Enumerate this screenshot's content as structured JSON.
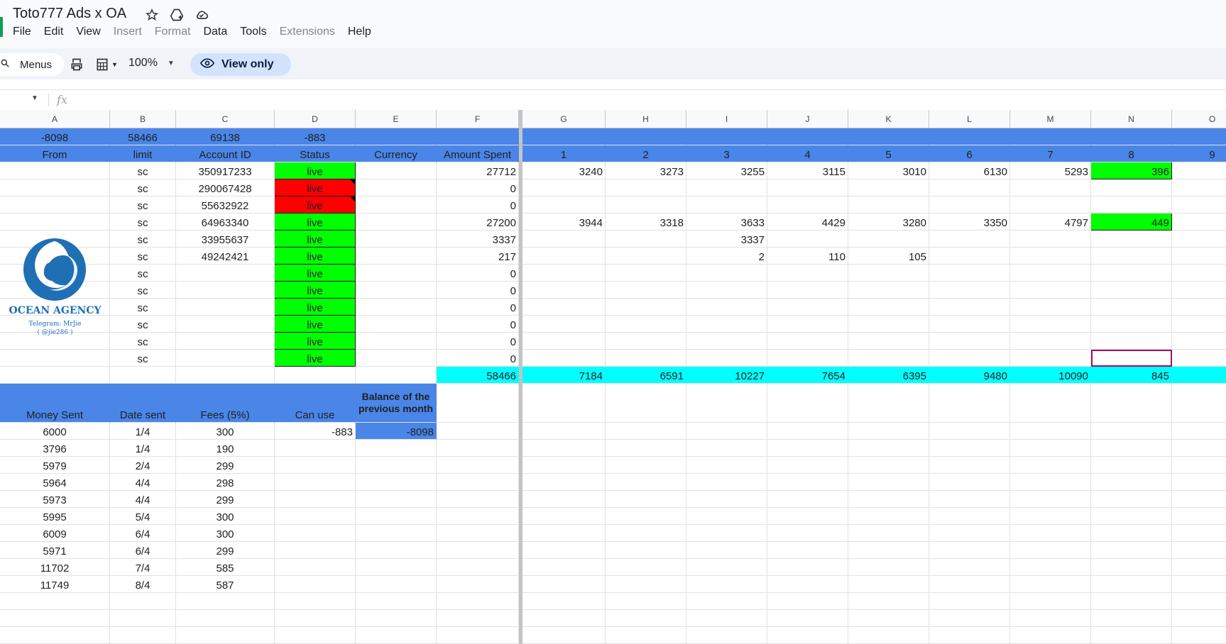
{
  "app": {
    "title": "Toto777 Ads x OA"
  },
  "menu": {
    "file": "File",
    "edit": "Edit",
    "view": "View",
    "insert": "Insert",
    "format": "Format",
    "data": "Data",
    "tools": "Tools",
    "extensions": "Extensions",
    "help": "Help"
  },
  "toolbar": {
    "menus": "Menus",
    "zoom": "100%",
    "view_only": "View only"
  },
  "formula": {
    "fx": "fx"
  },
  "columns": [
    "A",
    "B",
    "C",
    "D",
    "E",
    "F",
    "G",
    "H",
    "I",
    "J",
    "K",
    "L",
    "M",
    "N",
    "O"
  ],
  "row1": {
    "a": "-8098",
    "b": "58466",
    "c": "69138",
    "d": "-883"
  },
  "row2": {
    "a": "From",
    "b": "limit",
    "c": "Account ID",
    "d": "Status",
    "e": "Currency",
    "f": "Amount Spent",
    "days": [
      "1",
      "2",
      "3",
      "4",
      "5",
      "6",
      "7",
      "8",
      "9"
    ]
  },
  "accounts": [
    {
      "limit": "sc",
      "id": "350917233",
      "status": "live",
      "spent": "27712",
      "days": [
        "3240",
        "3273",
        "3255",
        "3115",
        "3010",
        "6130",
        "5293",
        "396",
        ""
      ]
    },
    {
      "limit": "sc",
      "id": "290067428",
      "status": "live",
      "spent": "0",
      "days": [
        "",
        "",
        "",
        "",
        "",
        "",
        "",
        "",
        ""
      ]
    },
    {
      "limit": "sc",
      "id": "55632922",
      "status": "live",
      "spent": "0",
      "days": [
        "",
        "",
        "",
        "",
        "",
        "",
        "",
        "",
        ""
      ]
    },
    {
      "limit": "sc",
      "id": "64963340",
      "status": "live",
      "spent": "27200",
      "days": [
        "3944",
        "3318",
        "3633",
        "4429",
        "3280",
        "3350",
        "4797",
        "449",
        ""
      ]
    },
    {
      "limit": "sc",
      "id": "33955637",
      "status": "live",
      "spent": "3337",
      "days": [
        "",
        "",
        "3337",
        "",
        "",
        "",
        "",
        "",
        ""
      ]
    },
    {
      "limit": "sc",
      "id": "49242421",
      "status": "live",
      "spent": "217",
      "days": [
        "",
        "",
        "2",
        "110",
        "105",
        "",
        "",
        "",
        ""
      ]
    },
    {
      "limit": "sc",
      "id": "",
      "status": "live",
      "spent": "0",
      "days": [
        "",
        "",
        "",
        "",
        "",
        "",
        "",
        "",
        ""
      ]
    },
    {
      "limit": "sc",
      "id": "",
      "status": "live",
      "spent": "0",
      "days": [
        "",
        "",
        "",
        "",
        "",
        "",
        "",
        "",
        ""
      ]
    },
    {
      "limit": "sc",
      "id": "",
      "status": "live",
      "spent": "0",
      "days": [
        "",
        "",
        "",
        "",
        "",
        "",
        "",
        "",
        ""
      ]
    },
    {
      "limit": "sc",
      "id": "",
      "status": "live",
      "spent": "0",
      "days": [
        "",
        "",
        "",
        "",
        "",
        "",
        "",
        "",
        ""
      ]
    },
    {
      "limit": "sc",
      "id": "",
      "status": "live",
      "spent": "0",
      "days": [
        "",
        "",
        "",
        "",
        "",
        "",
        "",
        "",
        ""
      ]
    },
    {
      "limit": "sc",
      "id": "",
      "status": "live",
      "spent": "0",
      "days": [
        "",
        "",
        "",
        "",
        "",
        "",
        "",
        "",
        ""
      ]
    }
  ],
  "totals": {
    "f": "58466",
    "days": [
      "7184",
      "6591",
      "10227",
      "7654",
      "6395",
      "9480",
      "10090",
      "845",
      ""
    ]
  },
  "logo": {
    "name": "OCEAN AGENCY",
    "telegram": "Telegram: MrJie",
    "handle": "( @jie286 )"
  },
  "payments_header": {
    "money": "Money Sent",
    "date": "Date sent",
    "fees": "Fees (5%)",
    "canuse": "Can use",
    "balance": "Balance of the previous month"
  },
  "payments_first": {
    "canuse": "-883",
    "balance": "-8098"
  },
  "payments": [
    {
      "money": "6000",
      "date": "1/4",
      "fees": "300"
    },
    {
      "money": "3796",
      "date": "1/4",
      "fees": "190"
    },
    {
      "money": "5979",
      "date": "2/4",
      "fees": "299"
    },
    {
      "money": "5964",
      "date": "4/4",
      "fees": "298"
    },
    {
      "money": "5973",
      "date": "4/4",
      "fees": "299"
    },
    {
      "money": "5995",
      "date": "5/4",
      "fees": "300"
    },
    {
      "money": "6009",
      "date": "6/4",
      "fees": "300"
    },
    {
      "money": "5971",
      "date": "6/4",
      "fees": "299"
    },
    {
      "money": "11702",
      "date": "7/4",
      "fees": "585"
    },
    {
      "money": "11749",
      "date": "8/4",
      "fees": "587"
    }
  ],
  "colors": {
    "header_blue": "#4a86e8",
    "status_live": "#00ff00",
    "status_alert": "#ff0000",
    "totals": "#00ffff"
  }
}
